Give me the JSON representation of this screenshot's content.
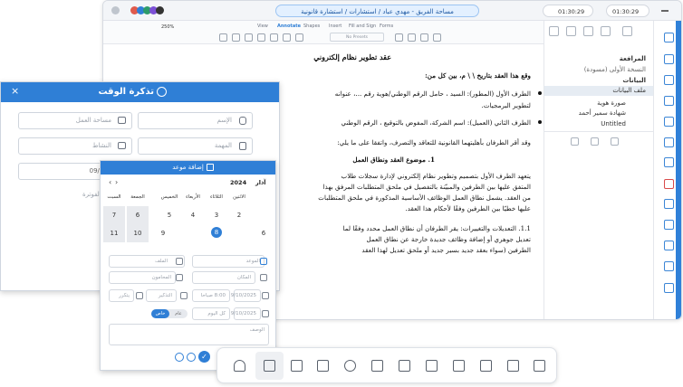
{
  "title_bar": {
    "title": "مساحة الفريق - مهدي عباد / استشارات / استشارة قانونية",
    "timer_1": "01:30:29",
    "timer_2": "01:30:29"
  },
  "ribbon": {
    "zoom": "250%",
    "tabs": [
      "View",
      "Annotate",
      "Shapes",
      "Insert",
      "Fill and Sign",
      "Forms"
    ],
    "active_tab": "Annotate",
    "presets_label": "No Presets"
  },
  "document": {
    "title": "عقد تطوير نظام إلكتروني",
    "lines": [
      "وقع هذا العقد بتاريخ   \\   \\   م، بين كل من:",
      "الطرف الأول (المطور): السيد ، حامل الرقم الوطني/هوية رقم ...، عنوانه",
      "لتطوير البرمجيات.",
      "الطرف الثاني (العميل): اسم الشركة، المفوض بالتوقيع ، الرقم الوطني",
      "وقد أقر الطرفان بأهليتهما القانونية للتعاقد والتصرف، واتفقا على ما يلي:",
      "1.   موضوع العقد ونطاق العمل",
      "يتعهد الطرف الأول بتصميم وتطوير نظام إلكتروني لإدارة سجلات طلاب",
      "المتفق عليها بين الطرفين والمبيّنة بالتفصيل في ملحق المتطلبات المرفق بهذا",
      "من العقد. يشمل نطاق العمل الوظائف الأساسية المذكورة في ملحق المتطلبات",
      "عليها خطيًا بين الطرفين وفقًا لأحكام هذا العقد.",
      "1.1.  التعديلات والتغييرات: يقر الطرفان أن نطاق العمل محدد وفقًا لما",
      "تعديل جوهري أو إضافة وظائف جديدة خارجة عن نطاق العمل",
      "الطرفين (سواء بعقد جديد بسير جديد أو ملحق تعديل لهذا العقد"
    ]
  },
  "tree": {
    "root": "المرافعة",
    "version": "النسخة الأولى (مسودة)",
    "data": "البيانات",
    "file": "ملف البيانات",
    "items": [
      "صورة هوية",
      "شهادة سمير أحمد",
      "Untitled"
    ]
  },
  "time_card": {
    "title": "تذكرة الوقت",
    "name_placeholder": "الإسم",
    "workspace_placeholder": "مساحة العمل",
    "task_placeholder": "المهمة",
    "activity_placeholder": "النشاط",
    "date_value": "09/09/2025",
    "invoice_placeholder": "الفوترة"
  },
  "appointment": {
    "title": "إضافة موعد",
    "month": "آذار",
    "year": "2024",
    "weekdays": [
      "الاثنين",
      "الثلاثاء",
      "الأربعاء",
      "الخميس",
      "الجمعة",
      "السبت"
    ],
    "days_row1": [
      "2",
      "3",
      "4",
      "5",
      "6",
      "7"
    ],
    "days_row2": [
      "9",
      "10",
      "11",
      "12"
    ],
    "selected_day": "8",
    "date_side": "6",
    "fields": {
      "date_label": "الموعد",
      "file_label": "الملف",
      "place_label": "المكان",
      "lawyer_label": "المحامون",
      "time_1": "8:00 صباحا",
      "date_1": "9/10/2025",
      "time_2": "كل اليوم",
      "date_2": "9/10/2025",
      "remind_label": "التذكير",
      "repeat_label": "يتكرر",
      "tag_private": "خاص",
      "tag_general": "عام",
      "description_label": "الوصف"
    }
  }
}
